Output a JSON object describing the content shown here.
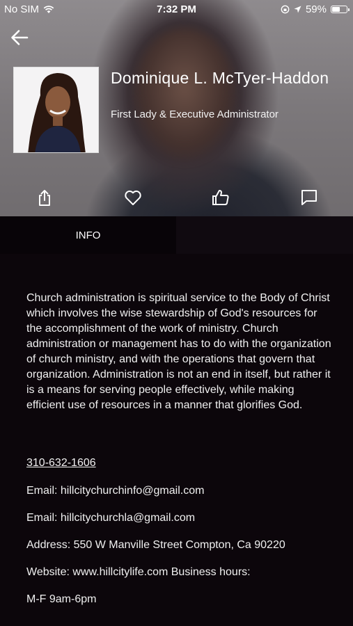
{
  "status_bar": {
    "carrier": "No SIM",
    "time": "7:32 PM",
    "battery": "59%",
    "battery_level": 0.59
  },
  "profile": {
    "name": "Dominique L. McTyer-Haddon",
    "title": "First Lady & Executive Administrator"
  },
  "actions": [
    "share-icon",
    "heart-icon",
    "thumbs-up-icon",
    "comment-icon"
  ],
  "tabs": {
    "info": "INFO"
  },
  "info": {
    "description": "Church administration is spiritual service to the Body of Christ which involves the wise stewardship of God's resources for the accomplishment of the work of ministry. Church administration or management has to do with the organization of church ministry, and with the operations that govern that organization. Administration is not an end in itself, but rather it is a means for serving people effectively, while making efficient use of resources in a manner that glorifies God.",
    "phone": "310-632-1606",
    "email1": "Email: hillcitychurchinfo@gmail.com",
    "email2": "Email: hillcitychurchla@gmail.com",
    "address": "Address: 550 W Manville Street Compton, Ca 90220",
    "website": "Website: www.hillcitylife.com Business hours:",
    "hours": "M-F 9am-6pm"
  }
}
